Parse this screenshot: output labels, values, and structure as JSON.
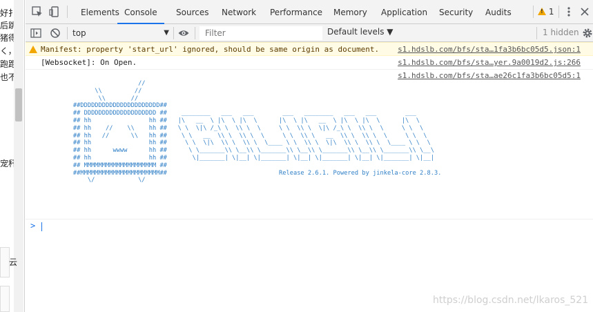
{
  "page_fragments": [
    "好扌",
    "后跳",
    "猪得",
    "く，",
    "跑跑",
    "也不",
    "宠秆",
    "云"
  ],
  "devtools": {
    "tabs": [
      {
        "label": "Elements",
        "active": false
      },
      {
        "label": "Console",
        "active": true
      },
      {
        "label": "Sources",
        "active": false
      },
      {
        "label": "Network",
        "active": false
      },
      {
        "label": "Performance",
        "active": false
      },
      {
        "label": "Memory",
        "active": false
      },
      {
        "label": "Application",
        "active": false
      },
      {
        "label": "Security",
        "active": false
      },
      {
        "label": "Audits",
        "active": false
      }
    ],
    "warning_count": "1",
    "more_icon": "vertical-dots-icon"
  },
  "toolbar": {
    "context": "top",
    "filter_placeholder": "Filter",
    "filter_value": "",
    "levels": "Default levels ▼",
    "hidden": "1 hidden"
  },
  "console": {
    "messages": [
      {
        "type": "warning",
        "text": "Manifest: property 'start_url' ignored, should be same origin as document.",
        "source": "s1.hdslb.com/bfs/sta…1fa3b6bc05d5.json:1"
      },
      {
        "type": "log",
        "text": "[Websocket]: On Open.",
        "source": "s1.hdslb.com/bfs/sta…yer.9a0019d2.js:266"
      },
      {
        "type": "log",
        "text": "",
        "source": "s1.hdslb.com/bfs/sta…ae26c1fa3b6bc05d5:1"
      }
    ],
    "ascii_art": "                      //\n          \\\\         //\n           \\\\       //\n    ##DDDDDDDDDDDDDDDDDDDDDD##\n    ## DDDDDDDDDDDDDDDDDDDD ##    ________   ___   ___        ___   ________   ___   ___        ___\n    ## hh                hh ##   |\\   __  \\ |\\  \\ |\\  \\      |\\  \\ |\\   __  \\ |\\  \\ |\\  \\      |\\  \\\n    ## hh    //    \\\\    hh ##   \\ \\  \\|\\ /_\\ \\  \\\\ \\  \\     \\ \\  \\\\ \\  \\|\\ /_\\ \\  \\\\ \\  \\     \\ \\  \\\n    ## hh   //      \\\\   hh ##    \\ \\   __  \\\\ \\  \\\\ \\  \\     \\ \\  \\\\ \\   __  \\\\ \\  \\\\ \\  \\     \\ \\  \\\n    ## hh                hh ##     \\ \\  \\|\\  \\\\ \\  \\\\ \\  \\____ \\ \\  \\\\ \\  \\|\\  \\\\ \\  \\\\ \\  \\____ \\ \\  \\\n    ## hh      wwww      hh ##      \\ \\_______\\\\ \\__\\\\ \\_______\\\\ \\__\\\\ \\_______\\\\ \\__\\\\ \\_______\\\\ \\__\\\n    ## hh                hh ##       \\|_______| \\|__| \\|_______| \\|__| \\|_______| \\|__| \\|_______| \\|__|\n    ## MMMMMMMMMMMMMMMMMMMM ##\n    ##MMMMMMMMMMMMMMMMMMMMMM##                               Release 2.6.1. Powered by jinkela-core 2.8.3.\n        \\/            \\/",
    "prompt": ">"
  },
  "watermark": "https://blog.csdn.net/lkaros_521",
  "colors": {
    "accent": "#1a73e8",
    "warning_bg": "#fffbe5",
    "art": "#2f7fc7"
  }
}
